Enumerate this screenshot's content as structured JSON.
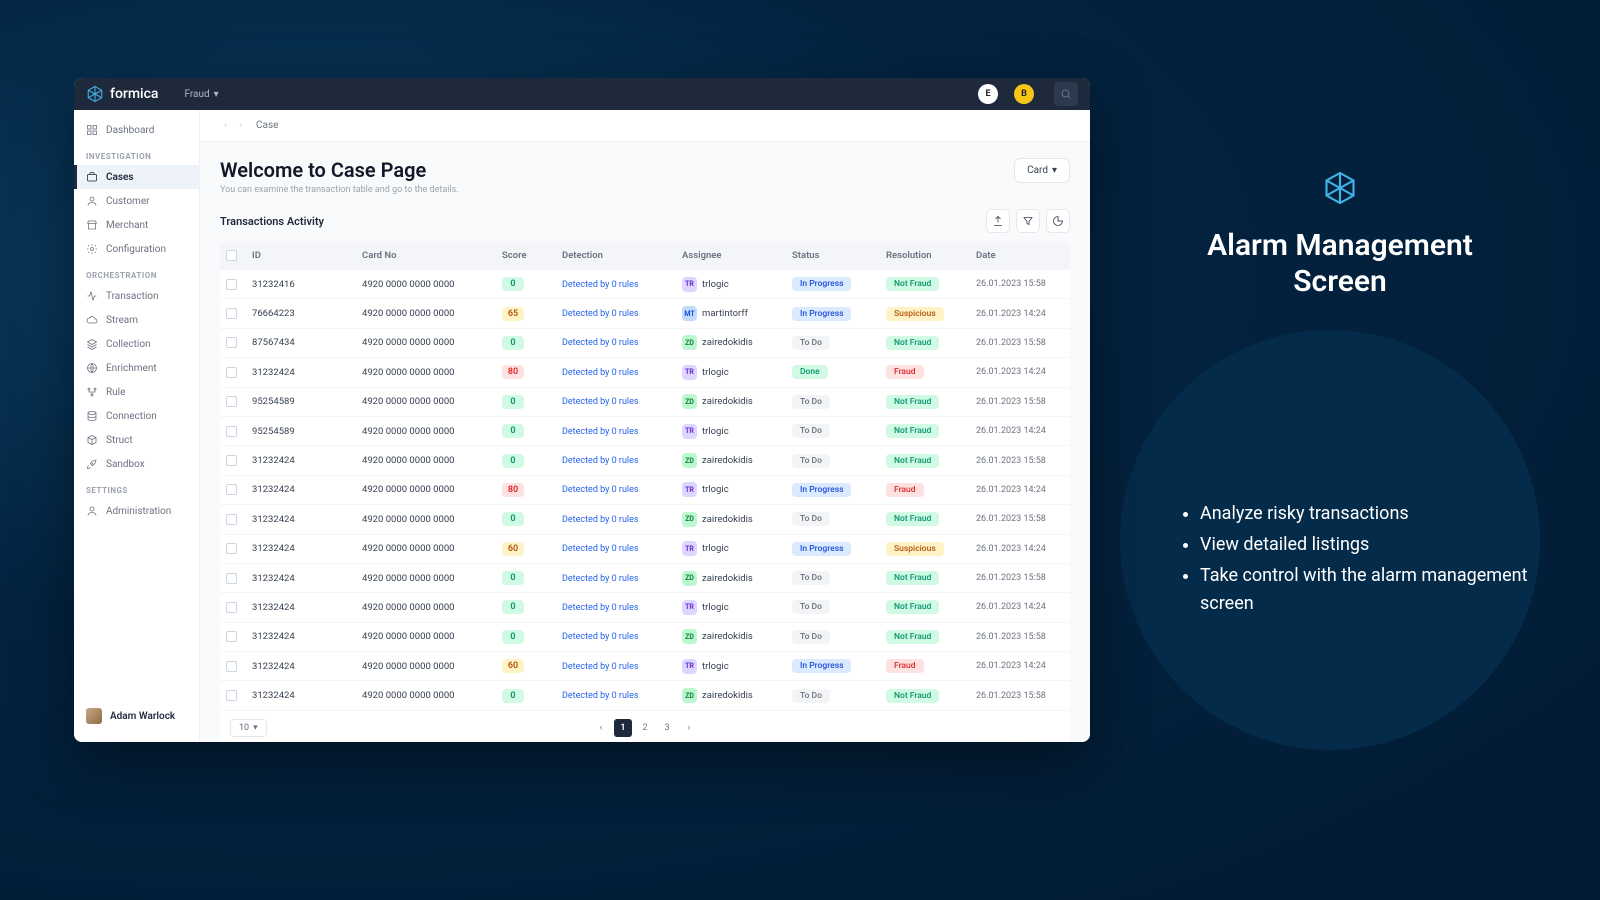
{
  "brand": "formica",
  "header": {
    "dropdown": "Fraud",
    "avatar1": "E",
    "avatar2": "B"
  },
  "sidebar": {
    "top": [
      {
        "label": "Dashboard"
      }
    ],
    "sections": [
      {
        "title": "INVESTIGATION",
        "items": [
          {
            "label": "Cases",
            "active": true
          },
          {
            "label": "Customer"
          },
          {
            "label": "Merchant"
          },
          {
            "label": "Configuration"
          }
        ]
      },
      {
        "title": "ORCHESTRATION",
        "items": [
          {
            "label": "Transaction"
          },
          {
            "label": "Stream"
          },
          {
            "label": "Collection"
          },
          {
            "label": "Enrichment"
          },
          {
            "label": "Rule"
          },
          {
            "label": "Connection"
          },
          {
            "label": "Struct"
          },
          {
            "label": "Sandbox"
          }
        ]
      },
      {
        "title": "SETTINGS",
        "items": [
          {
            "label": "Administration"
          }
        ]
      }
    ],
    "user": "Adam Warlock"
  },
  "breadcrumb": "Case",
  "page": {
    "title": "Welcome to Case Page",
    "subtitle": "You can examine the transaction table and go to the details.",
    "card_filter": "Card"
  },
  "activity_title": "Transactions Activity",
  "columns": [
    "",
    "ID",
    "Card No",
    "Score",
    "Detection",
    "Assignee",
    "Status",
    "Resolution",
    "Date"
  ],
  "rows": [
    {
      "id": "31232416",
      "card": "4920 0000 0000 0000",
      "score": "0",
      "score_c": "green",
      "det": "Detected by 0 rules",
      "as_i": "TR",
      "as_c": "tr",
      "as": "trlogic",
      "st": "In Progress",
      "st_c": "inprogress",
      "res": "Not Fraud",
      "res_c": "notfraud",
      "date": "26.01.2023 15:58"
    },
    {
      "id": "76664223",
      "card": "4920 0000 0000 0000",
      "score": "65",
      "score_c": "yellow",
      "det": "Detected by 0 rules",
      "as_i": "MT",
      "as_c": "mt",
      "as": "martintorff",
      "st": "In Progress",
      "st_c": "inprogress",
      "res": "Suspicious",
      "res_c": "suspicious",
      "date": "26.01.2023 14:24"
    },
    {
      "id": "87567434",
      "card": "4920 0000 0000 0000",
      "score": "0",
      "score_c": "green",
      "det": "Detected by 0 rules",
      "as_i": "ZD",
      "as_c": "zd",
      "as": "zairedokidis",
      "st": "To Do",
      "st_c": "todo",
      "res": "Not Fraud",
      "res_c": "notfraud",
      "date": "26.01.2023 15:58"
    },
    {
      "id": "31232424",
      "card": "4920 0000 0000 0000",
      "score": "80",
      "score_c": "red",
      "det": "Detected by 0 rules",
      "as_i": "TR",
      "as_c": "tr",
      "as": "trlogic",
      "st": "Done",
      "st_c": "done",
      "res": "Fraud",
      "res_c": "fraud",
      "date": "26.01.2023 14:24"
    },
    {
      "id": "95254589",
      "card": "4920 0000 0000 0000",
      "score": "0",
      "score_c": "green",
      "det": "Detected by 0 rules",
      "as_i": "ZD",
      "as_c": "zd",
      "as": "zairedokidis",
      "st": "To Do",
      "st_c": "todo",
      "res": "Not Fraud",
      "res_c": "notfraud",
      "date": "26.01.2023 15:58"
    },
    {
      "id": "95254589",
      "card": "4920 0000 0000 0000",
      "score": "0",
      "score_c": "green",
      "det": "Detected by 0 rules",
      "as_i": "TR",
      "as_c": "tr",
      "as": "trlogic",
      "st": "To Do",
      "st_c": "todo",
      "res": "Not Fraud",
      "res_c": "notfraud",
      "date": "26.01.2023 14:24"
    },
    {
      "id": "31232424",
      "card": "4920 0000 0000 0000",
      "score": "0",
      "score_c": "green",
      "det": "Detected by 0 rules",
      "as_i": "ZD",
      "as_c": "zd",
      "as": "zairedokidis",
      "st": "To Do",
      "st_c": "todo",
      "res": "Not Fraud",
      "res_c": "notfraud",
      "date": "26.01.2023 15:58"
    },
    {
      "id": "31232424",
      "card": "4920 0000 0000 0000",
      "score": "80",
      "score_c": "red",
      "det": "Detected by 0 rules",
      "as_i": "TR",
      "as_c": "tr",
      "as": "trlogic",
      "st": "In Progress",
      "st_c": "inprogress",
      "res": "Fraud",
      "res_c": "fraud",
      "date": "26.01.2023 14:24"
    },
    {
      "id": "31232424",
      "card": "4920 0000 0000 0000",
      "score": "0",
      "score_c": "green",
      "det": "Detected by 0 rules",
      "as_i": "ZD",
      "as_c": "zd",
      "as": "zairedokidis",
      "st": "To Do",
      "st_c": "todo",
      "res": "Not Fraud",
      "res_c": "notfraud",
      "date": "26.01.2023 15:58"
    },
    {
      "id": "31232424",
      "card": "4920 0000 0000 0000",
      "score": "60",
      "score_c": "yellow",
      "det": "Detected by 0 rules",
      "as_i": "TR",
      "as_c": "tr",
      "as": "trlogic",
      "st": "In Progress",
      "st_c": "inprogress",
      "res": "Suspicious",
      "res_c": "suspicious",
      "date": "26.01.2023 14:24"
    },
    {
      "id": "31232424",
      "card": "4920 0000 0000 0000",
      "score": "0",
      "score_c": "green",
      "det": "Detected by 0 rules",
      "as_i": "ZD",
      "as_c": "zd",
      "as": "zairedokidis",
      "st": "To Do",
      "st_c": "todo",
      "res": "Not Fraud",
      "res_c": "notfraud",
      "date": "26.01.2023 15:58"
    },
    {
      "id": "31232424",
      "card": "4920 0000 0000 0000",
      "score": "0",
      "score_c": "green",
      "det": "Detected by 0 rules",
      "as_i": "TR",
      "as_c": "tr",
      "as": "trlogic",
      "st": "To Do",
      "st_c": "todo",
      "res": "Not Fraud",
      "res_c": "notfraud",
      "date": "26.01.2023 14:24"
    },
    {
      "id": "31232424",
      "card": "4920 0000 0000 0000",
      "score": "0",
      "score_c": "green",
      "det": "Detected by 0 rules",
      "as_i": "ZD",
      "as_c": "zd",
      "as": "zairedokidis",
      "st": "To Do",
      "st_c": "todo",
      "res": "Not Fraud",
      "res_c": "notfraud",
      "date": "26.01.2023 15:58"
    },
    {
      "id": "31232424",
      "card": "4920 0000 0000 0000",
      "score": "60",
      "score_c": "yellow",
      "det": "Detected by 0 rules",
      "as_i": "TR",
      "as_c": "tr",
      "as": "trlogic",
      "st": "In Progress",
      "st_c": "inprogress",
      "res": "Fraud",
      "res_c": "fraud",
      "date": "26.01.2023 14:24"
    },
    {
      "id": "31232424",
      "card": "4920 0000 0000 0000",
      "score": "0",
      "score_c": "green",
      "det": "Detected by 0 rules",
      "as_i": "ZD",
      "as_c": "zd",
      "as": "zairedokidis",
      "st": "To Do",
      "st_c": "todo",
      "res": "Not Fraud",
      "res_c": "notfraud",
      "date": "26.01.2023 15:58"
    }
  ],
  "page_size": "10",
  "pages": [
    "1",
    "2",
    "3"
  ],
  "caption": {
    "title1": "Alarm Management",
    "title2": "Screen",
    "bullets": [
      "Analyze risky transactions",
      "View detailed listings",
      "Take control with the alarm management screen"
    ]
  }
}
